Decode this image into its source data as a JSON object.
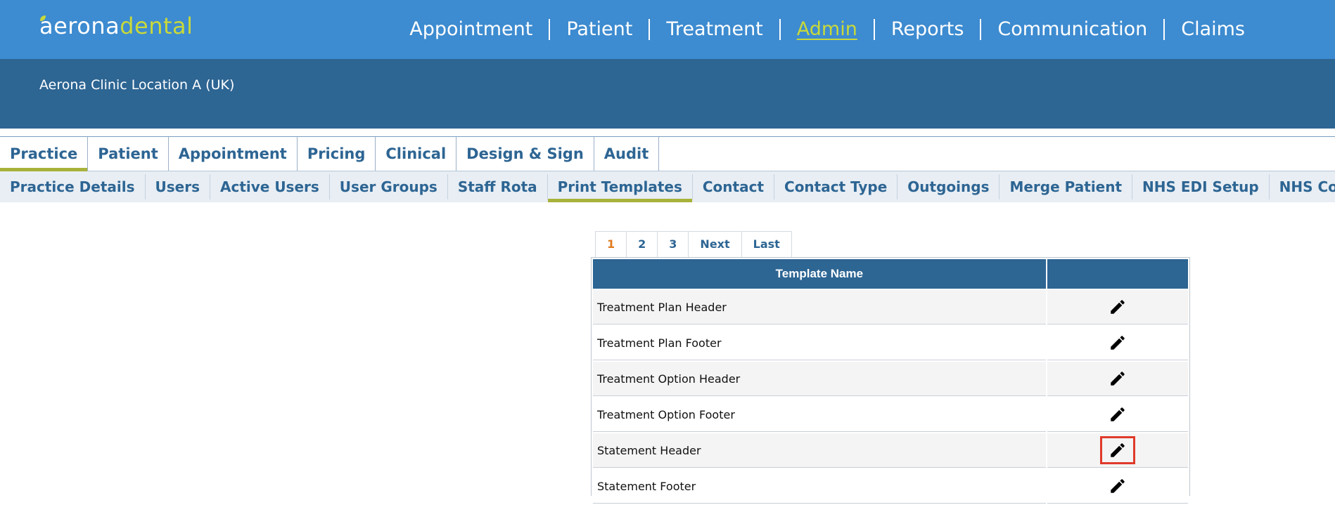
{
  "logo": {
    "part1": "aerona",
    "part2": "dental"
  },
  "main_nav": [
    {
      "label": "Appointment",
      "active": false
    },
    {
      "label": "Patient",
      "active": false
    },
    {
      "label": "Treatment",
      "active": false
    },
    {
      "label": "Admin",
      "active": true
    },
    {
      "label": "Reports",
      "active": false
    },
    {
      "label": "Communication",
      "active": false
    },
    {
      "label": "Claims",
      "active": false
    }
  ],
  "location": "Aerona Clinic Location A (UK)",
  "tabs": [
    "Practice",
    "Patient",
    "Appointment",
    "Pricing",
    "Clinical",
    "Design & Sign",
    "Audit"
  ],
  "active_tab": "Practice",
  "subtabs": [
    "Practice Details",
    "Users",
    "Active Users",
    "User Groups",
    "Staff Rota",
    "Print Templates",
    "Contact",
    "Contact Type",
    "Outgoings",
    "Merge Patient",
    "NHS EDI Setup",
    "NHS Contract"
  ],
  "active_subtab": "Print Templates",
  "pagination": {
    "pages": [
      "1",
      "2",
      "3"
    ],
    "current": "1",
    "next": "Next",
    "last": "Last"
  },
  "table": {
    "header": "Template Name",
    "rows": [
      {
        "name": "Treatment Plan Header",
        "icon": "pencil-icon"
      },
      {
        "name": "Treatment Plan Footer",
        "icon": "pencil-icon"
      },
      {
        "name": "Treatment Option Header",
        "icon": "pencil-icon"
      },
      {
        "name": "Treatment Option Footer",
        "icon": "pencil-icon"
      },
      {
        "name": "Statement Header",
        "icon": "pencil-icon",
        "highlighted": true
      },
      {
        "name": "Statement Footer",
        "icon": "pencil-icon"
      }
    ]
  },
  "colors": {
    "topbar": "#3d8bd0",
    "band": "#2d6593",
    "accent": "#c8d93a",
    "tab_underline": "#a8b23a",
    "highlight": "#e03a2a",
    "current_page": "#e07a1f"
  }
}
